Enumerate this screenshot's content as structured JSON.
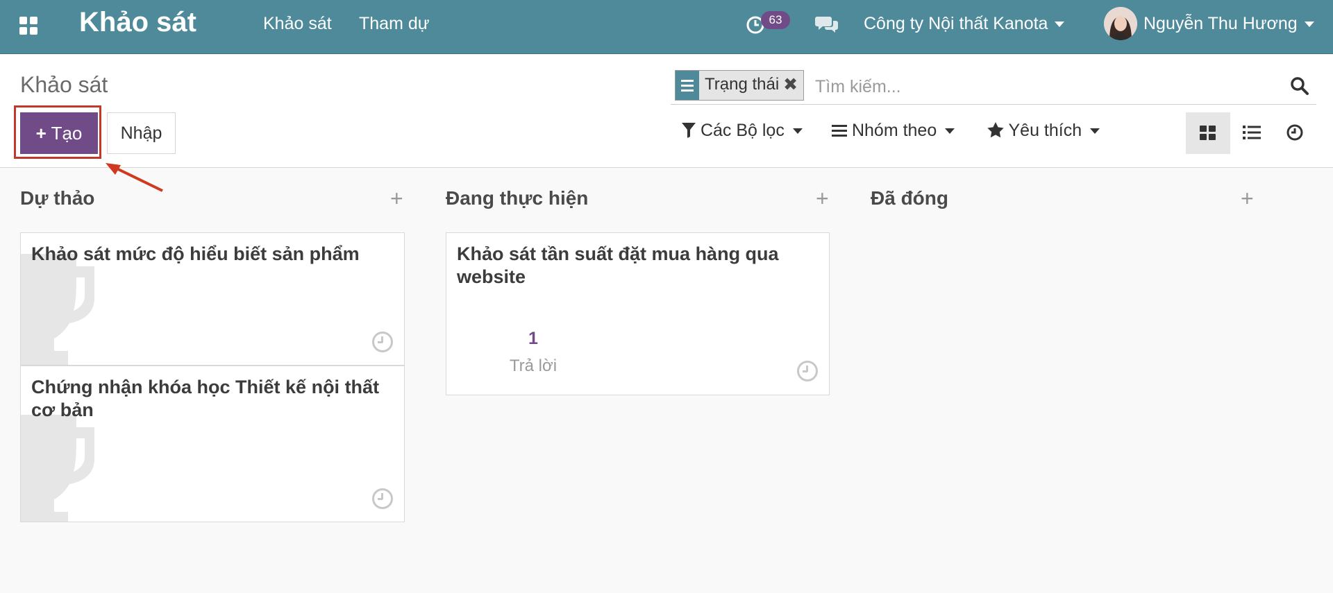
{
  "navbar": {
    "brand": "Khảo sát",
    "menu": [
      "Khảo sát",
      "Tham dự"
    ],
    "activity_count": "63",
    "company": "Công ty Nội thất Kanota",
    "user": "Nguyễn Thu Hương"
  },
  "control_panel": {
    "breadcrumb": "Khảo sát",
    "create_label": "Tạo",
    "import_label": "Nhập",
    "facet_label": "Trạng thái",
    "search_placeholder": "Tìm kiếm...",
    "filters_label": "Các Bộ lọc",
    "group_by_label": "Nhóm theo",
    "favorites_label": "Yêu thích"
  },
  "columns": [
    {
      "title": "Dự thảo",
      "cards": [
        {
          "title": "Khảo sát mức độ hiểu biết sản phẩm"
        },
        {
          "title": "Chứng nhận khóa học Thiết kế nội thất cơ bản"
        }
      ]
    },
    {
      "title": "Đang thực hiện",
      "cards": [
        {
          "title": "Khảo sát tần suất đặt mua hàng qua website",
          "count": "1",
          "count_label": "Trả lời"
        }
      ]
    },
    {
      "title": "Đã đóng",
      "cards": []
    }
  ]
}
